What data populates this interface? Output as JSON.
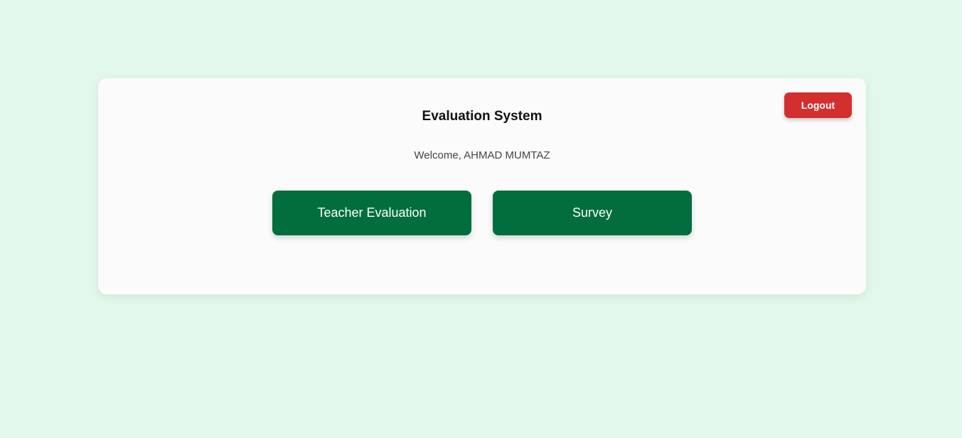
{
  "header": {
    "title": "Evaluation System",
    "logout_label": "Logout"
  },
  "welcome": "Welcome, AHMAD MUMTAZ",
  "actions": [
    {
      "label": "Teacher Evaluation"
    },
    {
      "label": "Survey"
    }
  ],
  "colors": {
    "background": "#e2f8ea",
    "primary": "#026e3d",
    "danger": "#d32f2f"
  }
}
